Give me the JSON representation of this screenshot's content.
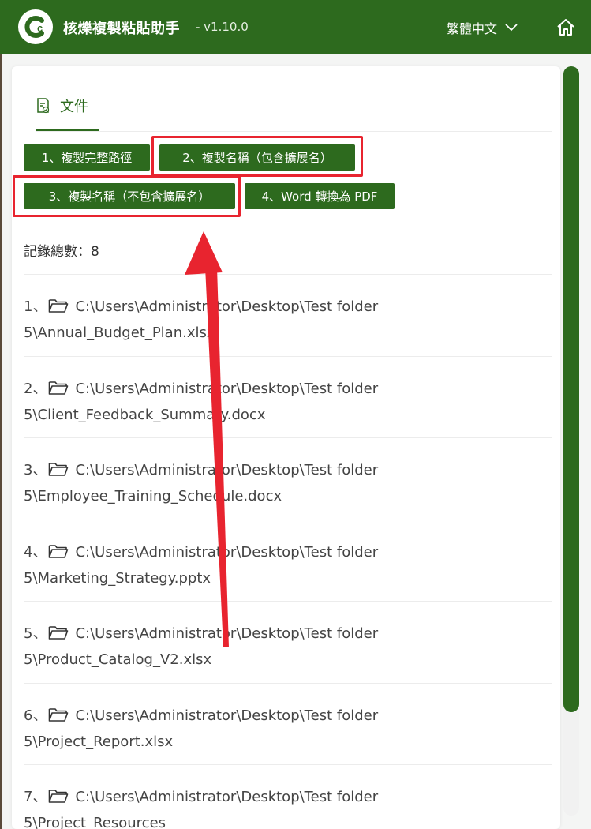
{
  "header": {
    "title": "核爍複製粘貼助手",
    "version": "- v1.10.0",
    "language": "繁體中文",
    "colors": {
      "brand": "#2d6a1e",
      "highlight": "#e8242f"
    }
  },
  "tab": {
    "label": "文件",
    "icon": "document-check-icon"
  },
  "buttons": {
    "b1": "1、複製完整路徑",
    "b2": "2、複製名稱（包含擴展名）",
    "b3": "3、複製名稱（不包含擴展名）",
    "b4": "4、Word 轉換為 PDF"
  },
  "record_count": "記錄總數：8",
  "records": [
    {
      "num": "1、",
      "line1": "C:\\Users\\Administrator\\Desktop\\Test folder",
      "line2": "5\\Annual_Budget_Plan.xlsx"
    },
    {
      "num": "2、",
      "line1": "C:\\Users\\Administrator\\Desktop\\Test folder",
      "line2": "5\\Client_Feedback_Summary.docx"
    },
    {
      "num": "3、",
      "line1": "C:\\Users\\Administrator\\Desktop\\Test folder",
      "line2": "5\\Employee_Training_Schedule.docx"
    },
    {
      "num": "4、",
      "line1": "C:\\Users\\Administrator\\Desktop\\Test folder",
      "line2": "5\\Marketing_Strategy.pptx"
    },
    {
      "num": "5、",
      "line1": "C:\\Users\\Administrator\\Desktop\\Test folder",
      "line2": "5\\Product_Catalog_V2.xlsx"
    },
    {
      "num": "6、",
      "line1": "C:\\Users\\Administrator\\Desktop\\Test folder",
      "line2": "5\\Project_Report.xlsx"
    },
    {
      "num": "7、",
      "line1": "C:\\Users\\Administrator\\Desktop\\Test folder",
      "line2": "5\\Project_Resources"
    }
  ]
}
